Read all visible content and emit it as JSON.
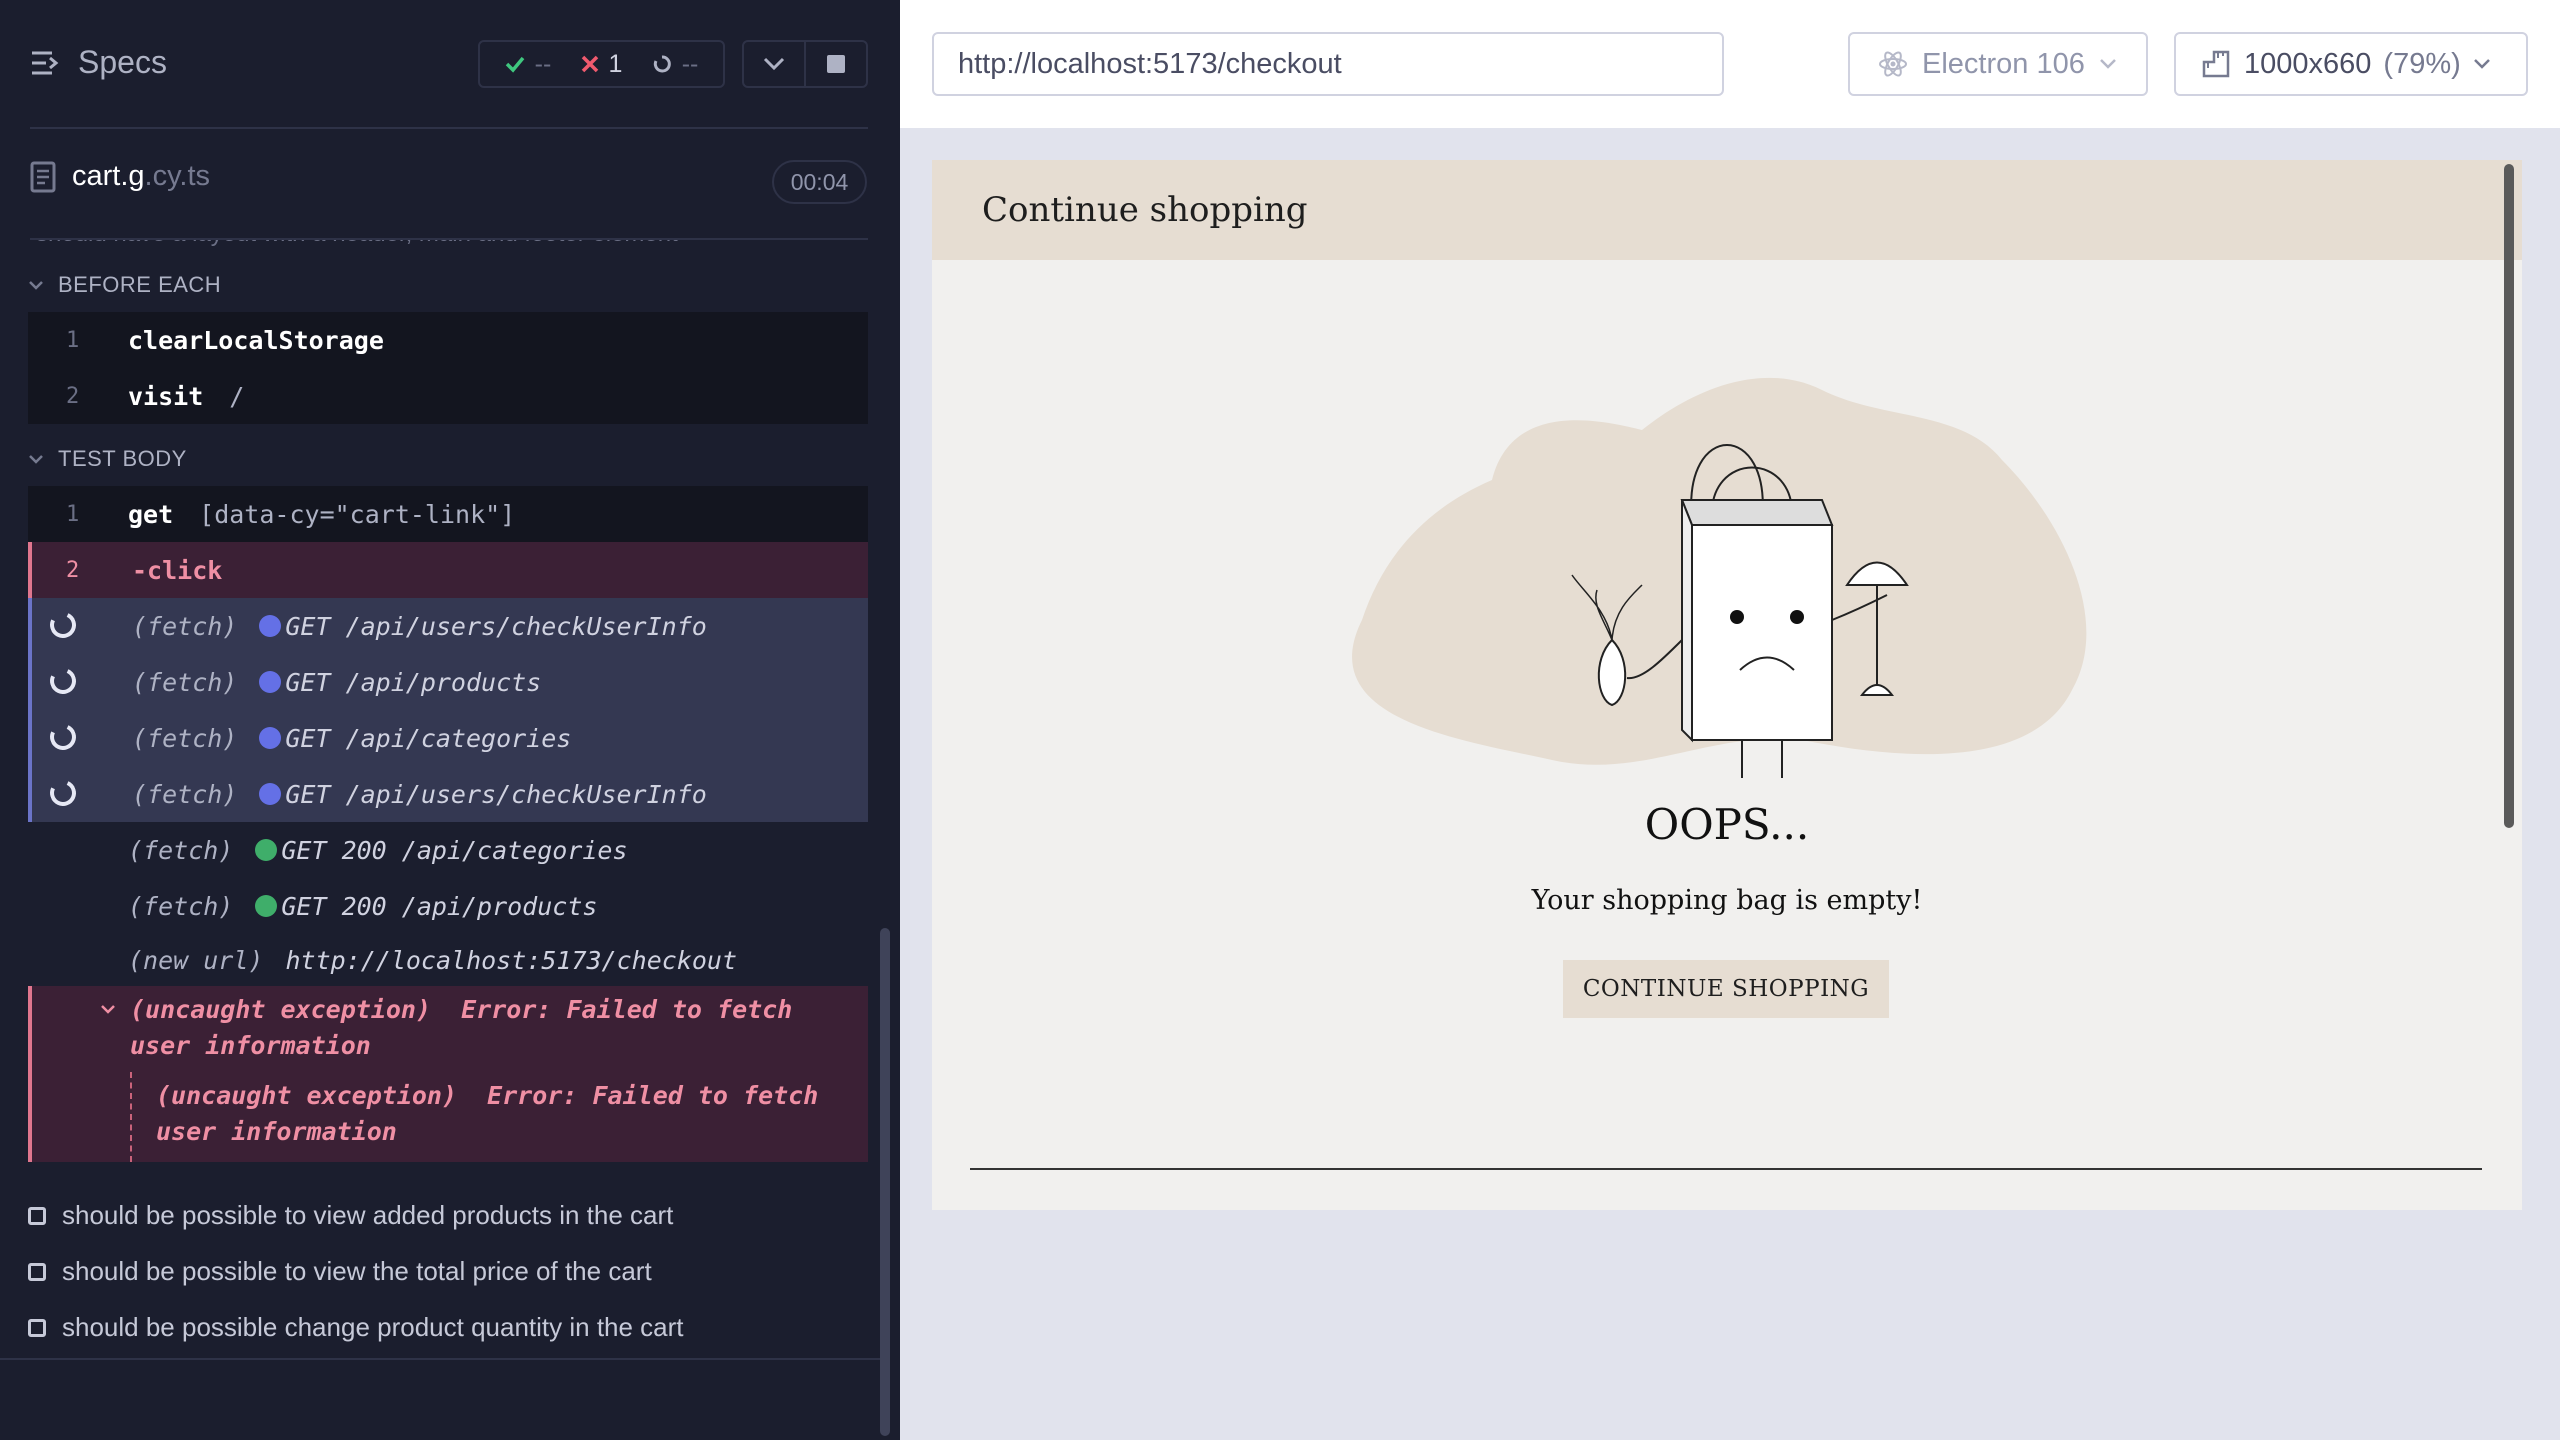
{
  "reporter": {
    "specs_label": "Specs",
    "stats": {
      "passed": "--",
      "failed": "1",
      "pending": "--"
    },
    "spec": {
      "name": "cart.g",
      "ext": ".cy.ts",
      "duration": "00:04"
    },
    "cutoff_text": "should have a layout with a header, main and footer element",
    "before_each": {
      "title": "BEFORE EACH",
      "commands": [
        {
          "num": "1",
          "cmd": "clearLocalStorage",
          "msg": ""
        },
        {
          "num": "2",
          "cmd": "visit",
          "msg": "/"
        }
      ]
    },
    "test_body": {
      "title": "TEST BODY",
      "commands": [
        {
          "num": "1",
          "cmd": "get",
          "msg": "[data-cy=\"cart-link\"]"
        },
        {
          "num": "2",
          "cmd": "-click",
          "msg": ""
        }
      ],
      "requests": [
        {
          "kind": "(fetch)",
          "msg": "GET /api/users/checkUserInfo",
          "status": "pending"
        },
        {
          "kind": "(fetch)",
          "msg": "GET /api/products",
          "status": "pending"
        },
        {
          "kind": "(fetch)",
          "msg": "GET /api/categories",
          "status": "pending"
        },
        {
          "kind": "(fetch)",
          "msg": "GET /api/users/checkUserInfo",
          "status": "pending"
        },
        {
          "kind": "(fetch)",
          "msg": "GET 200 /api/categories",
          "status": "done"
        },
        {
          "kind": "(fetch)",
          "msg": "GET 200 /api/products",
          "status": "done"
        }
      ],
      "new_url": {
        "kind": "(new url)",
        "msg": "http://localhost:5173/checkout"
      },
      "error": {
        "kind": "(uncaught exception)",
        "msg": "Error: Failed to fetch user information",
        "nested_kind": "(uncaught exception)",
        "nested_msg": "Error: Failed to fetch user information"
      }
    },
    "tests": [
      "should be possible to view added products in the cart",
      "should be possible to view the total price of the cart",
      "should be possible change product quantity in the cart"
    ]
  },
  "aut": {
    "url": "http://localhost:5173/checkout",
    "browser": "Electron 106",
    "viewport": "1000x660",
    "scale": "(79%)",
    "app": {
      "header": "Continue shopping",
      "oops": "OOPS...",
      "empty": "Your shopping bag is empty!",
      "button": "CONTINUE SHOPPING"
    }
  },
  "colors": {
    "pending_dot": "#6470e6",
    "done_dot": "#3fae6a",
    "pass": "#3fc77f",
    "fail": "#f05a6e",
    "app_accent": "#e6ddd2"
  }
}
